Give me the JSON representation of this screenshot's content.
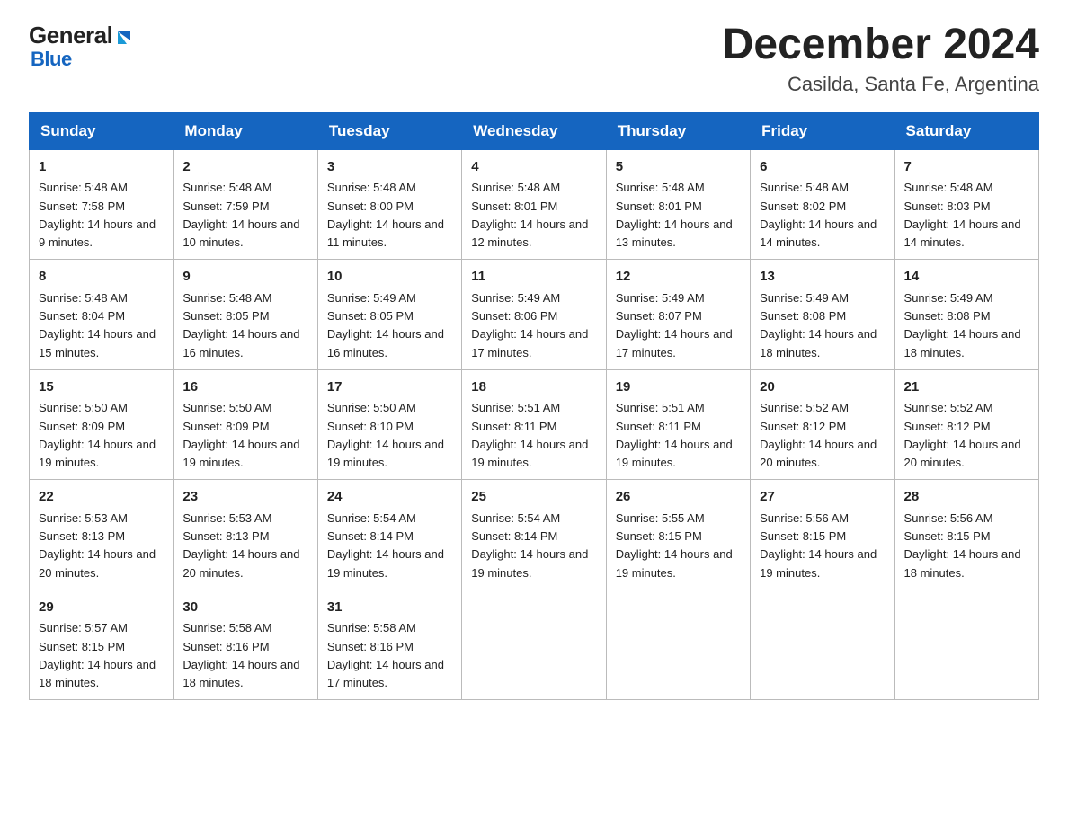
{
  "header": {
    "logo_general": "General",
    "logo_blue": "Blue",
    "month_title": "December 2024",
    "subtitle": "Casilda, Santa Fe, Argentina"
  },
  "days_of_week": [
    "Sunday",
    "Monday",
    "Tuesday",
    "Wednesday",
    "Thursday",
    "Friday",
    "Saturday"
  ],
  "weeks": [
    [
      {
        "day": "1",
        "sunrise": "5:48 AM",
        "sunset": "7:58 PM",
        "daylight": "14 hours and 9 minutes."
      },
      {
        "day": "2",
        "sunrise": "5:48 AM",
        "sunset": "7:59 PM",
        "daylight": "14 hours and 10 minutes."
      },
      {
        "day": "3",
        "sunrise": "5:48 AM",
        "sunset": "8:00 PM",
        "daylight": "14 hours and 11 minutes."
      },
      {
        "day": "4",
        "sunrise": "5:48 AM",
        "sunset": "8:01 PM",
        "daylight": "14 hours and 12 minutes."
      },
      {
        "day": "5",
        "sunrise": "5:48 AM",
        "sunset": "8:01 PM",
        "daylight": "14 hours and 13 minutes."
      },
      {
        "day": "6",
        "sunrise": "5:48 AM",
        "sunset": "8:02 PM",
        "daylight": "14 hours and 14 minutes."
      },
      {
        "day": "7",
        "sunrise": "5:48 AM",
        "sunset": "8:03 PM",
        "daylight": "14 hours and 14 minutes."
      }
    ],
    [
      {
        "day": "8",
        "sunrise": "5:48 AM",
        "sunset": "8:04 PM",
        "daylight": "14 hours and 15 minutes."
      },
      {
        "day": "9",
        "sunrise": "5:48 AM",
        "sunset": "8:05 PM",
        "daylight": "14 hours and 16 minutes."
      },
      {
        "day": "10",
        "sunrise": "5:49 AM",
        "sunset": "8:05 PM",
        "daylight": "14 hours and 16 minutes."
      },
      {
        "day": "11",
        "sunrise": "5:49 AM",
        "sunset": "8:06 PM",
        "daylight": "14 hours and 17 minutes."
      },
      {
        "day": "12",
        "sunrise": "5:49 AM",
        "sunset": "8:07 PM",
        "daylight": "14 hours and 17 minutes."
      },
      {
        "day": "13",
        "sunrise": "5:49 AM",
        "sunset": "8:08 PM",
        "daylight": "14 hours and 18 minutes."
      },
      {
        "day": "14",
        "sunrise": "5:49 AM",
        "sunset": "8:08 PM",
        "daylight": "14 hours and 18 minutes."
      }
    ],
    [
      {
        "day": "15",
        "sunrise": "5:50 AM",
        "sunset": "8:09 PM",
        "daylight": "14 hours and 19 minutes."
      },
      {
        "day": "16",
        "sunrise": "5:50 AM",
        "sunset": "8:09 PM",
        "daylight": "14 hours and 19 minutes."
      },
      {
        "day": "17",
        "sunrise": "5:50 AM",
        "sunset": "8:10 PM",
        "daylight": "14 hours and 19 minutes."
      },
      {
        "day": "18",
        "sunrise": "5:51 AM",
        "sunset": "8:11 PM",
        "daylight": "14 hours and 19 minutes."
      },
      {
        "day": "19",
        "sunrise": "5:51 AM",
        "sunset": "8:11 PM",
        "daylight": "14 hours and 19 minutes."
      },
      {
        "day": "20",
        "sunrise": "5:52 AM",
        "sunset": "8:12 PM",
        "daylight": "14 hours and 20 minutes."
      },
      {
        "day": "21",
        "sunrise": "5:52 AM",
        "sunset": "8:12 PM",
        "daylight": "14 hours and 20 minutes."
      }
    ],
    [
      {
        "day": "22",
        "sunrise": "5:53 AM",
        "sunset": "8:13 PM",
        "daylight": "14 hours and 20 minutes."
      },
      {
        "day": "23",
        "sunrise": "5:53 AM",
        "sunset": "8:13 PM",
        "daylight": "14 hours and 20 minutes."
      },
      {
        "day": "24",
        "sunrise": "5:54 AM",
        "sunset": "8:14 PM",
        "daylight": "14 hours and 19 minutes."
      },
      {
        "day": "25",
        "sunrise": "5:54 AM",
        "sunset": "8:14 PM",
        "daylight": "14 hours and 19 minutes."
      },
      {
        "day": "26",
        "sunrise": "5:55 AM",
        "sunset": "8:15 PM",
        "daylight": "14 hours and 19 minutes."
      },
      {
        "day": "27",
        "sunrise": "5:56 AM",
        "sunset": "8:15 PM",
        "daylight": "14 hours and 19 minutes."
      },
      {
        "day": "28",
        "sunrise": "5:56 AM",
        "sunset": "8:15 PM",
        "daylight": "14 hours and 18 minutes."
      }
    ],
    [
      {
        "day": "29",
        "sunrise": "5:57 AM",
        "sunset": "8:15 PM",
        "daylight": "14 hours and 18 minutes."
      },
      {
        "day": "30",
        "sunrise": "5:58 AM",
        "sunset": "8:16 PM",
        "daylight": "14 hours and 18 minutes."
      },
      {
        "day": "31",
        "sunrise": "5:58 AM",
        "sunset": "8:16 PM",
        "daylight": "14 hours and 17 minutes."
      },
      null,
      null,
      null,
      null
    ]
  ]
}
